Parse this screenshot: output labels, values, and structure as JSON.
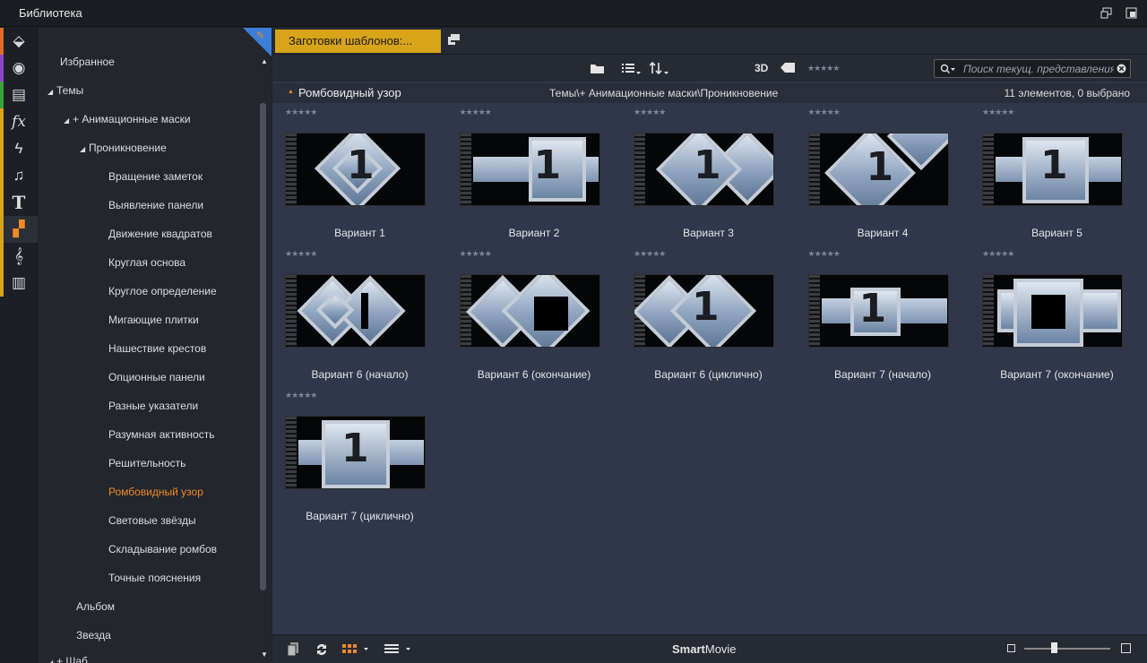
{
  "window": {
    "title": "Библиотека"
  },
  "rail": {
    "items": [
      {
        "name": "import-icon",
        "glyph": "⬙",
        "bar": "#e06b2a"
      },
      {
        "name": "film-reel-icon",
        "glyph": "◉",
        "bar": "#8e44c8"
      },
      {
        "name": "projects-icon",
        "glyph": "▤",
        "bar": "#3aa13a"
      },
      {
        "name": "effects-icon",
        "glyph": "fx",
        "bar": "#d7a41a"
      },
      {
        "name": "transitions-icon",
        "glyph": "ϟ",
        "bar": "#d7a41a"
      },
      {
        "name": "music-icon",
        "glyph": "♫",
        "bar": "#d7a41a"
      },
      {
        "name": "title-icon",
        "glyph": "T",
        "bar": "#d7a41a"
      },
      {
        "name": "montage-icon",
        "glyph": "▞",
        "bar": "#d7a41a"
      },
      {
        "name": "score-icon",
        "glyph": "𝄞",
        "bar": "#d7a41a"
      },
      {
        "name": "piano-icon",
        "glyph": "▥",
        "bar": "#d7a41a"
      }
    ]
  },
  "tree": {
    "favorites": "Избранное",
    "themes": "Темы",
    "anim_masks": "+ Анимационные маски",
    "penetration": "Проникновение",
    "children": [
      "Вращение заметок",
      "Выявление панели",
      "Движение квадратов",
      "Круглая основа",
      "Круглое определение",
      "Мигающие плитки",
      "Нашествие крестов",
      "Опционные панели",
      "Разные указатели",
      "Разумная активность",
      "Решительность",
      "Ромбовидный узор",
      "Световые звёзды",
      "Складывание ромбов",
      "Точные пояснения"
    ],
    "selected_index": 11,
    "album": "Альбом",
    "star": "Звезда",
    "partial": "+ Шаб"
  },
  "tab": {
    "label": "Заготовки шаблонов:..."
  },
  "toolbar": {
    "three_d": "3D",
    "stars": "★★★★★",
    "search_placeholder": "Поиск текущ. представления"
  },
  "header": {
    "name": "Ромбовидный узор",
    "path": "Темы\\+ Анимационные маски\\Проникновение",
    "count": "11 элементов, 0 выбрано"
  },
  "items": [
    {
      "caption": "Вариант 1",
      "rating": "★★★★★",
      "style": "d1"
    },
    {
      "caption": "Вариант 2",
      "rating": "★★★★★",
      "style": "d2"
    },
    {
      "caption": "Вариант 3",
      "rating": "★★★★★",
      "style": "d3"
    },
    {
      "caption": "Вариант 4",
      "rating": "★★★★★",
      "style": "d4"
    },
    {
      "caption": "Вариант 5",
      "rating": "★★★★★",
      "style": "s5"
    },
    {
      "caption": "Вариант 6 (начало)",
      "rating": "★★★★★",
      "style": "d6a"
    },
    {
      "caption": "Вариант 6 (окончание)",
      "rating": "★★★★★",
      "style": "d6b"
    },
    {
      "caption": "Вариант 6 (циклично)",
      "rating": "★★★★★",
      "style": "d6c"
    },
    {
      "caption": "Вариант 7 (начало)",
      "rating": "★★★★★",
      "style": "s7a"
    },
    {
      "caption": "Вариант 7 (окончание)",
      "rating": "★★★★★",
      "style": "s7b"
    },
    {
      "caption": "Вариант 7 (циклично)",
      "rating": "★★★★★",
      "style": "s7c"
    }
  ],
  "thumb_digit": "1",
  "bottom": {
    "brand_bold": "Smart",
    "brand_light": "Movie"
  },
  "colors": {
    "accent": "#f08a24",
    "tab": "#d7a41a",
    "corner": "#3d7ed8"
  }
}
